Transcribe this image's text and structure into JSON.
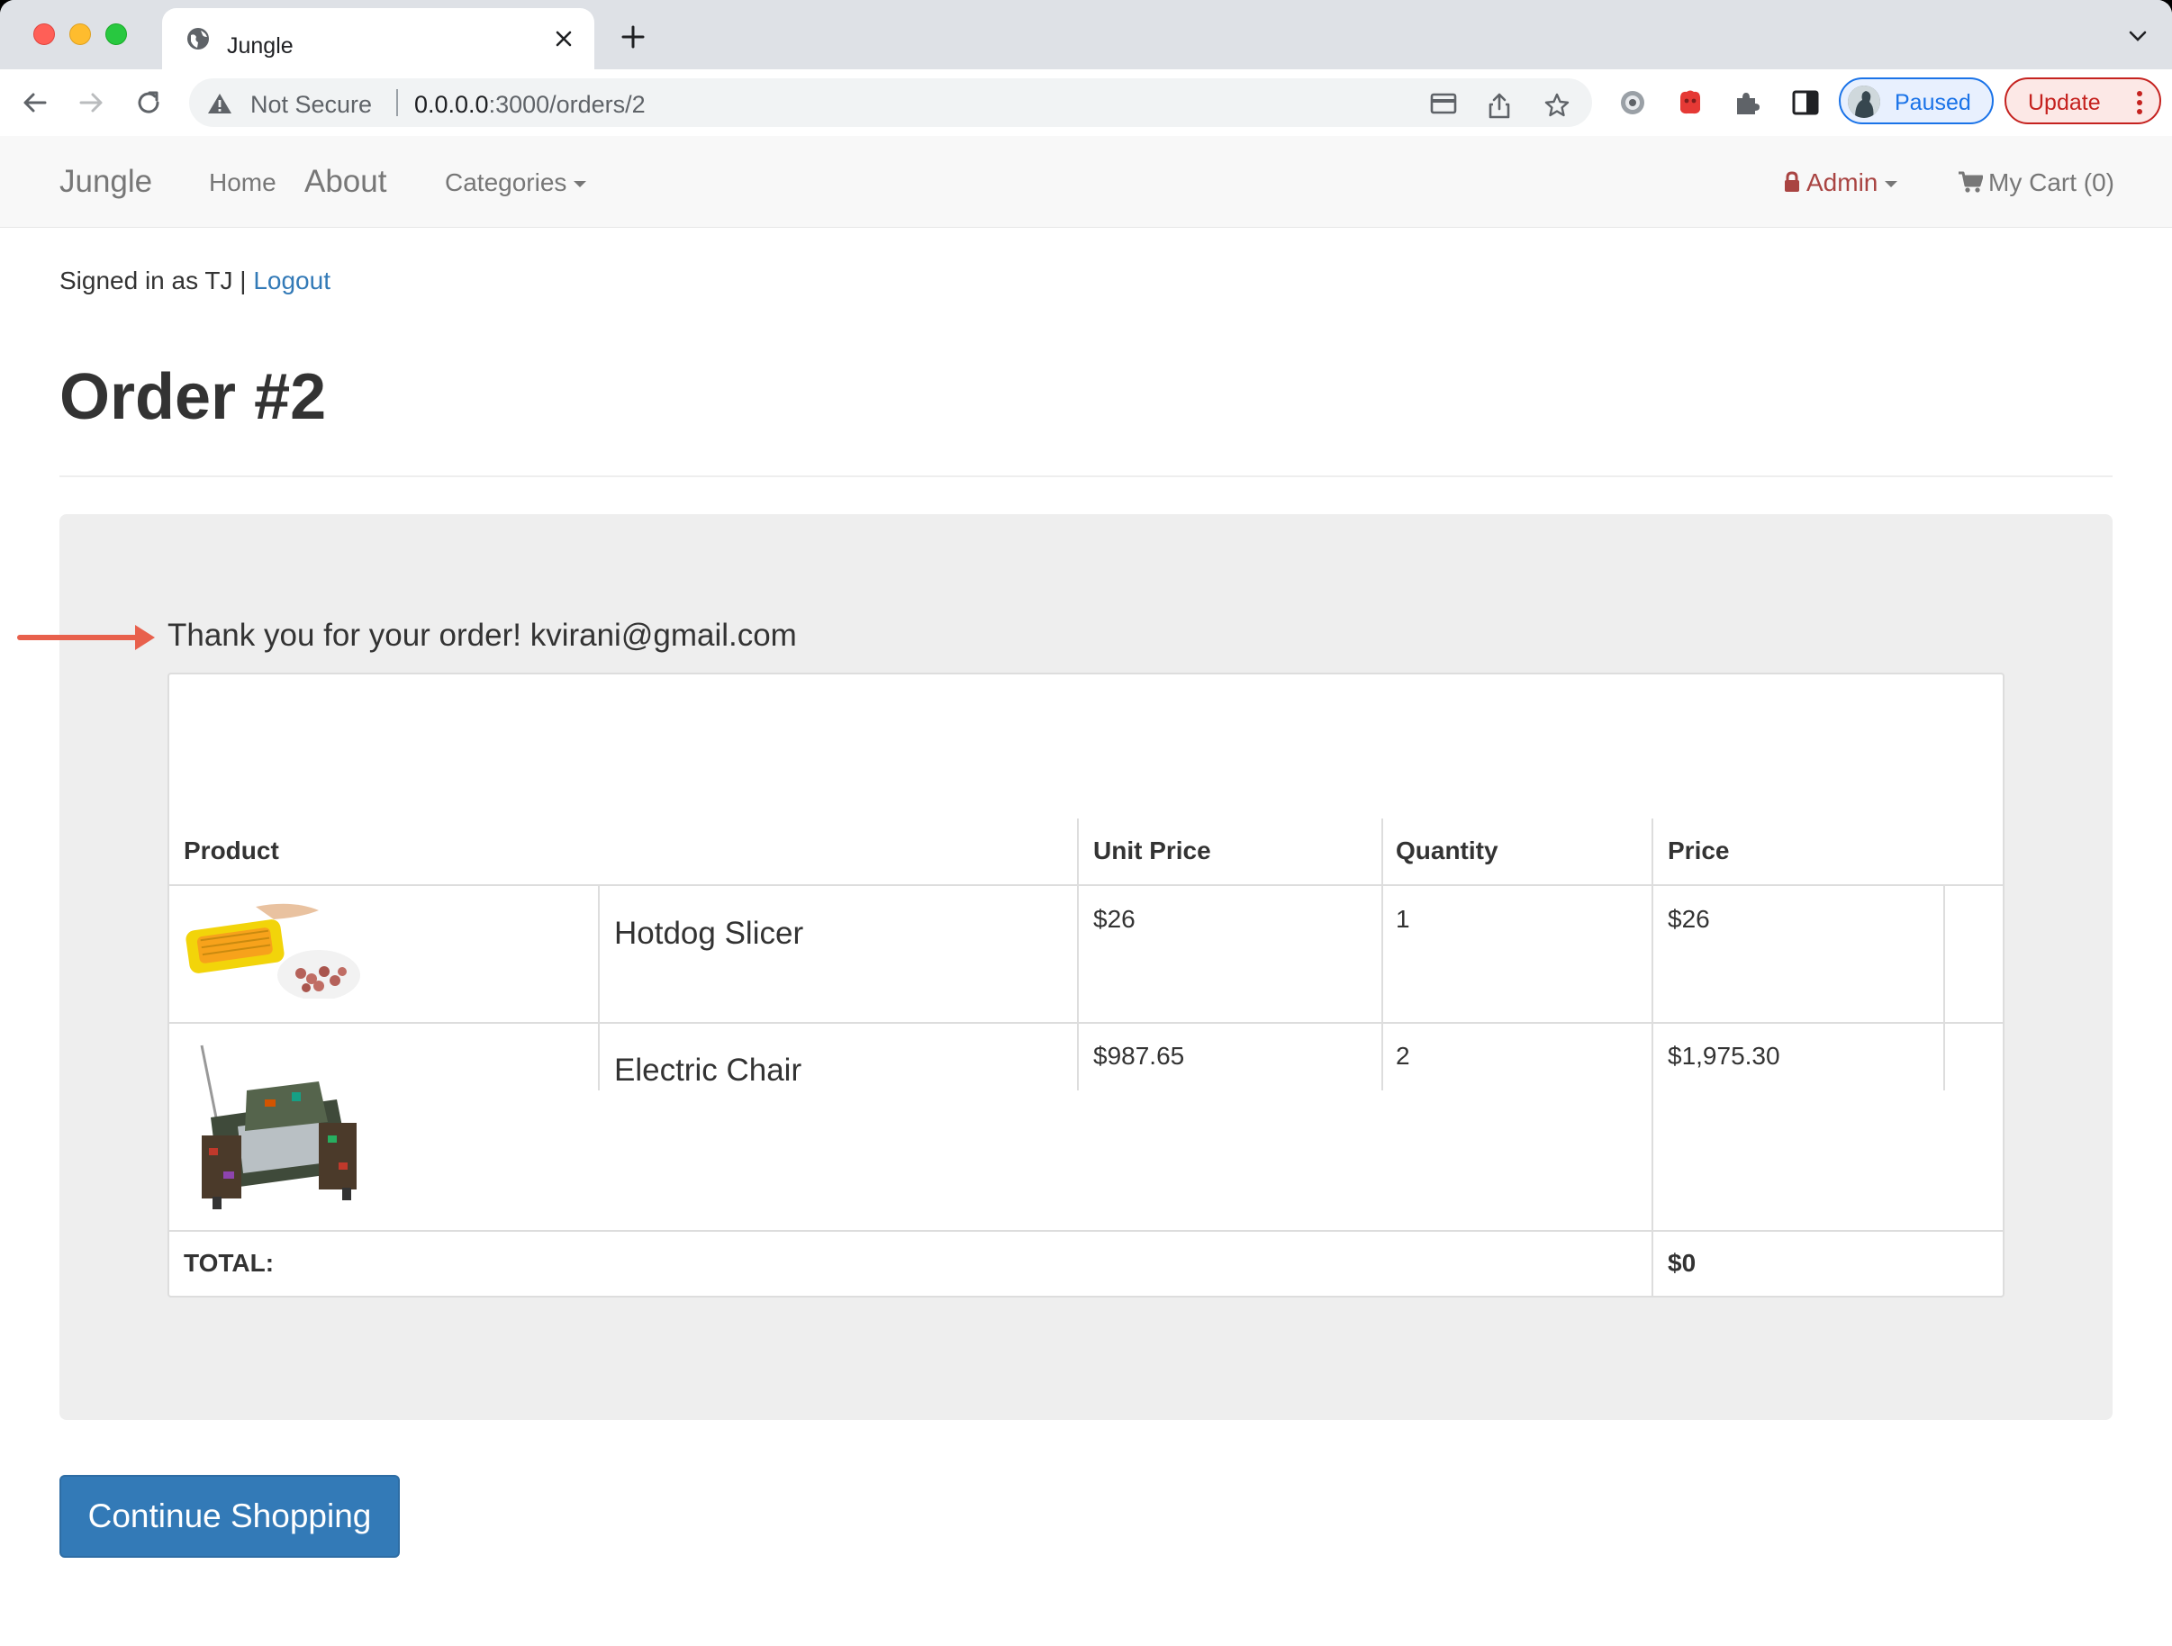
{
  "browser": {
    "tab_title": "Jungle",
    "url_warning": "Not Secure",
    "url_host": "0.0.0.0",
    "url_path": ":3000/orders/2",
    "profile_label": "Paused",
    "update_label": "Update"
  },
  "navbar": {
    "brand": "Jungle",
    "home": "Home",
    "about": "About",
    "categories": "Categories",
    "admin": "Admin",
    "cart": "My Cart (0)"
  },
  "session": {
    "signed_in_text": "Signed in as TJ | ",
    "logout": "Logout"
  },
  "order": {
    "title": "Order #2",
    "thanks": "Thank you for your order! kvirani@gmail.com",
    "headers": {
      "product": "Product",
      "unit_price": "Unit Price",
      "quantity": "Quantity",
      "price": "Price"
    },
    "items": [
      {
        "name": "Hotdog Slicer",
        "unit_price": "$26",
        "quantity": "1",
        "price": "$26"
      },
      {
        "name": "Electric Chair",
        "unit_price": "$987.65",
        "quantity": "2",
        "price": "$1,975.30"
      }
    ],
    "total_label": "TOTAL:",
    "total_value": "$0"
  },
  "actions": {
    "continue_shopping": "Continue Shopping"
  },
  "colors": {
    "primary": "#337ab7",
    "admin": "#a94442",
    "annotation_arrow": "#e8604c"
  }
}
